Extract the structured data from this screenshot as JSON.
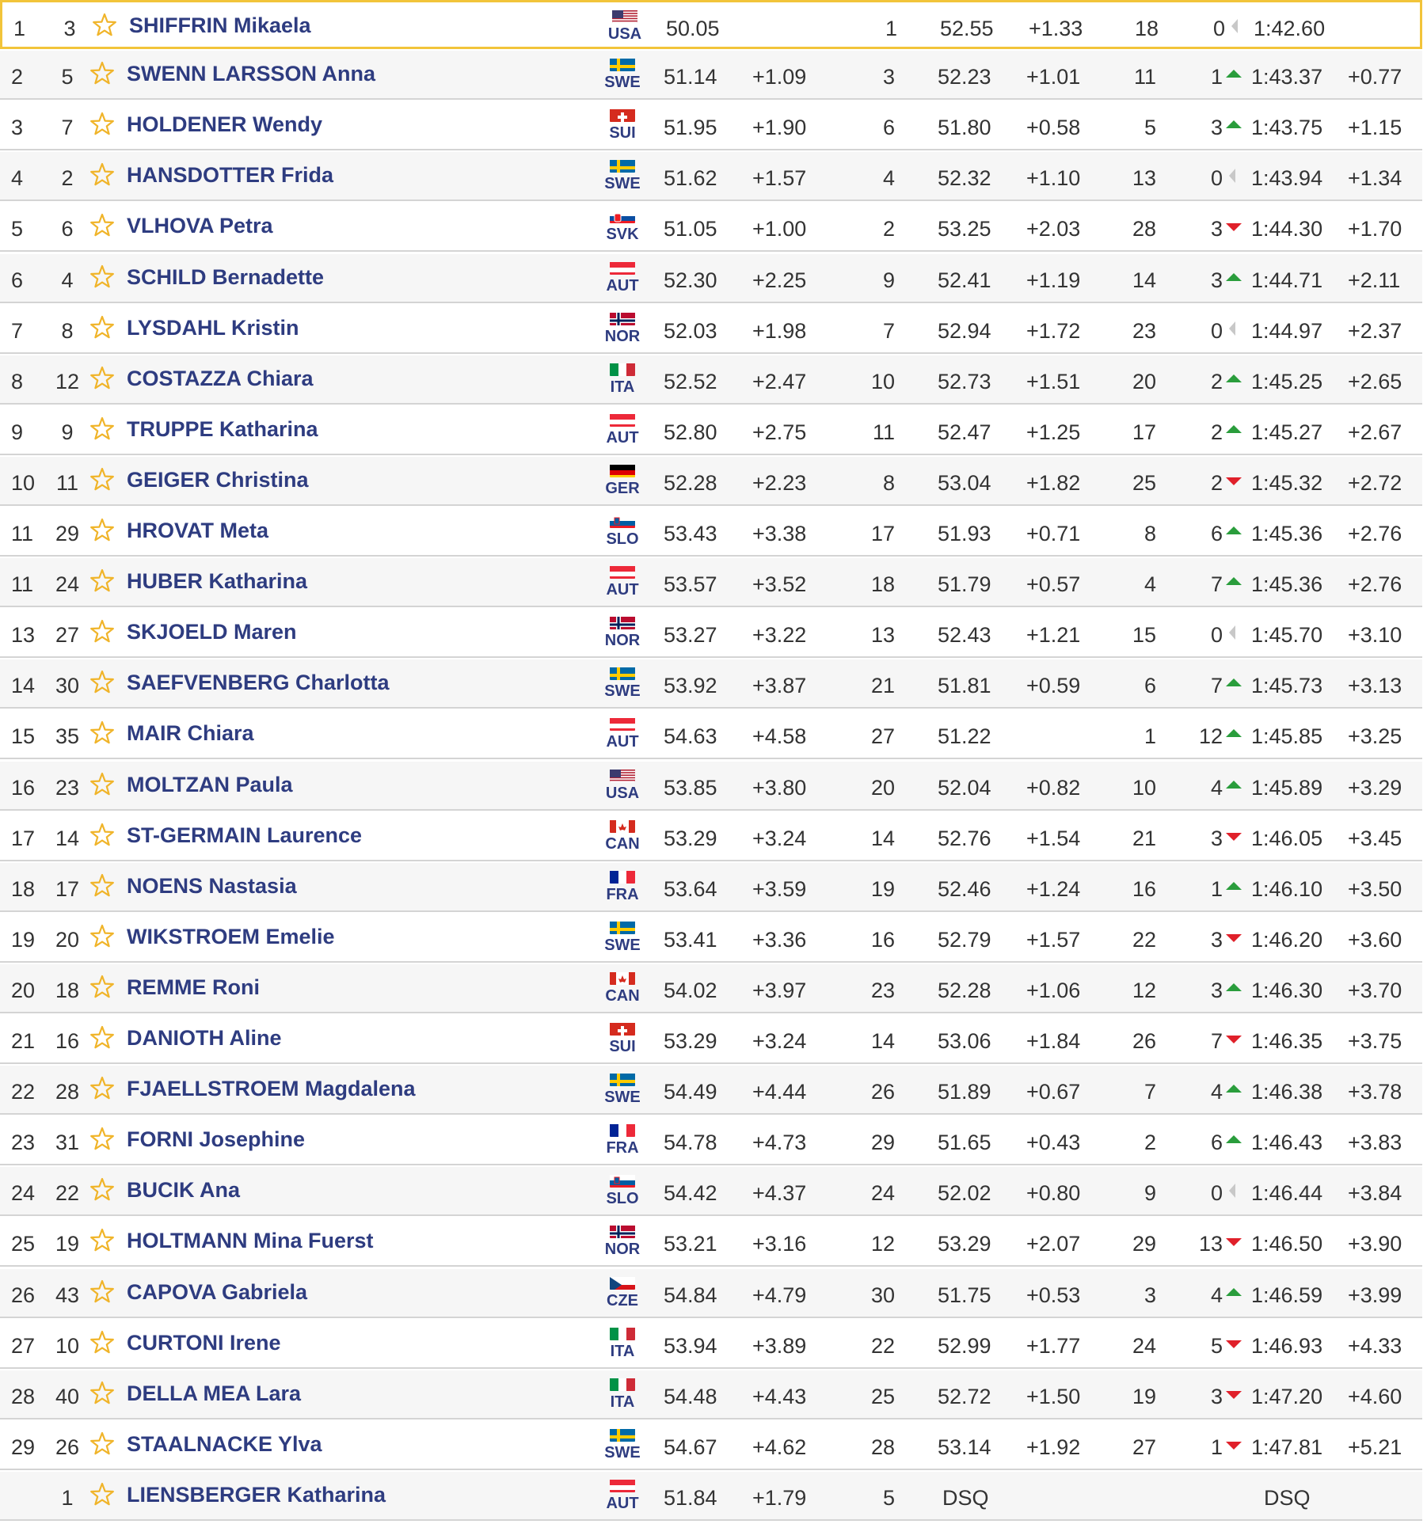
{
  "colors": {
    "name_text": "#2e3c80",
    "star": "#f0b429",
    "highlight_border": "#f2c43a",
    "arrow_up": "#2a9d3c",
    "arrow_down": "#e0202a",
    "arrow_same": "#c8c8c8"
  },
  "icons": {
    "favorite": "star-outline-icon",
    "up": "triangle-up-icon",
    "down": "triangle-down-icon",
    "same": "triangle-left-icon"
  },
  "rows": [
    {
      "rank": "1",
      "bib": "3",
      "name": "SHIFFRIN Mikaela",
      "nat": "USA",
      "r1_time": "50.05",
      "r1_diff": "",
      "r2_rank": "1",
      "r2_time": "52.55",
      "r2_diff": "+1.33",
      "run2_rank": "18",
      "move": "0",
      "dir": "same",
      "total": "1:42.60",
      "total_diff": "",
      "highlight": true
    },
    {
      "rank": "2",
      "bib": "5",
      "name": "SWENN LARSSON Anna",
      "nat": "SWE",
      "r1_time": "51.14",
      "r1_diff": "+1.09",
      "r2_rank": "3",
      "r2_time": "52.23",
      "r2_diff": "+1.01",
      "run2_rank": "11",
      "move": "1",
      "dir": "up",
      "total": "1:43.37",
      "total_diff": "+0.77"
    },
    {
      "rank": "3",
      "bib": "7",
      "name": "HOLDENER Wendy",
      "nat": "SUI",
      "r1_time": "51.95",
      "r1_diff": "+1.90",
      "r2_rank": "6",
      "r2_time": "51.80",
      "r2_diff": "+0.58",
      "run2_rank": "5",
      "move": "3",
      "dir": "up",
      "total": "1:43.75",
      "total_diff": "+1.15"
    },
    {
      "rank": "4",
      "bib": "2",
      "name": "HANSDOTTER Frida",
      "nat": "SWE",
      "r1_time": "51.62",
      "r1_diff": "+1.57",
      "r2_rank": "4",
      "r2_time": "52.32",
      "r2_diff": "+1.10",
      "run2_rank": "13",
      "move": "0",
      "dir": "same",
      "total": "1:43.94",
      "total_diff": "+1.34"
    },
    {
      "rank": "5",
      "bib": "6",
      "name": "VLHOVA Petra",
      "nat": "SVK",
      "r1_time": "51.05",
      "r1_diff": "+1.00",
      "r2_rank": "2",
      "r2_time": "53.25",
      "r2_diff": "+2.03",
      "run2_rank": "28",
      "move": "3",
      "dir": "down",
      "total": "1:44.30",
      "total_diff": "+1.70"
    },
    {
      "rank": "6",
      "bib": "4",
      "name": "SCHILD Bernadette",
      "nat": "AUT",
      "r1_time": "52.30",
      "r1_diff": "+2.25",
      "r2_rank": "9",
      "r2_time": "52.41",
      "r2_diff": "+1.19",
      "run2_rank": "14",
      "move": "3",
      "dir": "up",
      "total": "1:44.71",
      "total_diff": "+2.11"
    },
    {
      "rank": "7",
      "bib": "8",
      "name": "LYSDAHL Kristin",
      "nat": "NOR",
      "r1_time": "52.03",
      "r1_diff": "+1.98",
      "r2_rank": "7",
      "r2_time": "52.94",
      "r2_diff": "+1.72",
      "run2_rank": "23",
      "move": "0",
      "dir": "same",
      "total": "1:44.97",
      "total_diff": "+2.37"
    },
    {
      "rank": "8",
      "bib": "12",
      "name": "COSTAZZA Chiara",
      "nat": "ITA",
      "r1_time": "52.52",
      "r1_diff": "+2.47",
      "r2_rank": "10",
      "r2_time": "52.73",
      "r2_diff": "+1.51",
      "run2_rank": "20",
      "move": "2",
      "dir": "up",
      "total": "1:45.25",
      "total_diff": "+2.65"
    },
    {
      "rank": "9",
      "bib": "9",
      "name": "TRUPPE Katharina",
      "nat": "AUT",
      "r1_time": "52.80",
      "r1_diff": "+2.75",
      "r2_rank": "11",
      "r2_time": "52.47",
      "r2_diff": "+1.25",
      "run2_rank": "17",
      "move": "2",
      "dir": "up",
      "total": "1:45.27",
      "total_diff": "+2.67"
    },
    {
      "rank": "10",
      "bib": "11",
      "name": "GEIGER Christina",
      "nat": "GER",
      "r1_time": "52.28",
      "r1_diff": "+2.23",
      "r2_rank": "8",
      "r2_time": "53.04",
      "r2_diff": "+1.82",
      "run2_rank": "25",
      "move": "2",
      "dir": "down",
      "total": "1:45.32",
      "total_diff": "+2.72"
    },
    {
      "rank": "11",
      "bib": "29",
      "name": "HROVAT Meta",
      "nat": "SLO",
      "r1_time": "53.43",
      "r1_diff": "+3.38",
      "r2_rank": "17",
      "r2_time": "51.93",
      "r2_diff": "+0.71",
      "run2_rank": "8",
      "move": "6",
      "dir": "up",
      "total": "1:45.36",
      "total_diff": "+2.76"
    },
    {
      "rank": "11",
      "bib": "24",
      "name": "HUBER Katharina",
      "nat": "AUT",
      "r1_time": "53.57",
      "r1_diff": "+3.52",
      "r2_rank": "18",
      "r2_time": "51.79",
      "r2_diff": "+0.57",
      "run2_rank": "4",
      "move": "7",
      "dir": "up",
      "total": "1:45.36",
      "total_diff": "+2.76"
    },
    {
      "rank": "13",
      "bib": "27",
      "name": "SKJOELD Maren",
      "nat": "NOR",
      "r1_time": "53.27",
      "r1_diff": "+3.22",
      "r2_rank": "13",
      "r2_time": "52.43",
      "r2_diff": "+1.21",
      "run2_rank": "15",
      "move": "0",
      "dir": "same",
      "total": "1:45.70",
      "total_diff": "+3.10"
    },
    {
      "rank": "14",
      "bib": "30",
      "name": "SAEFVENBERG Charlotta",
      "nat": "SWE",
      "r1_time": "53.92",
      "r1_diff": "+3.87",
      "r2_rank": "21",
      "r2_time": "51.81",
      "r2_diff": "+0.59",
      "run2_rank": "6",
      "move": "7",
      "dir": "up",
      "total": "1:45.73",
      "total_diff": "+3.13"
    },
    {
      "rank": "15",
      "bib": "35",
      "name": "MAIR Chiara",
      "nat": "AUT",
      "r1_time": "54.63",
      "r1_diff": "+4.58",
      "r2_rank": "27",
      "r2_time": "51.22",
      "r2_diff": "",
      "run2_rank": "1",
      "move": "12",
      "dir": "up",
      "total": "1:45.85",
      "total_diff": "+3.25"
    },
    {
      "rank": "16",
      "bib": "23",
      "name": "MOLTZAN Paula",
      "nat": "USA",
      "r1_time": "53.85",
      "r1_diff": "+3.80",
      "r2_rank": "20",
      "r2_time": "52.04",
      "r2_diff": "+0.82",
      "run2_rank": "10",
      "move": "4",
      "dir": "up",
      "total": "1:45.89",
      "total_diff": "+3.29"
    },
    {
      "rank": "17",
      "bib": "14",
      "name": "ST-GERMAIN Laurence",
      "nat": "CAN",
      "r1_time": "53.29",
      "r1_diff": "+3.24",
      "r2_rank": "14",
      "r2_time": "52.76",
      "r2_diff": "+1.54",
      "run2_rank": "21",
      "move": "3",
      "dir": "down",
      "total": "1:46.05",
      "total_diff": "+3.45"
    },
    {
      "rank": "18",
      "bib": "17",
      "name": "NOENS Nastasia",
      "nat": "FRA",
      "r1_time": "53.64",
      "r1_diff": "+3.59",
      "r2_rank": "19",
      "r2_time": "52.46",
      "r2_diff": "+1.24",
      "run2_rank": "16",
      "move": "1",
      "dir": "up",
      "total": "1:46.10",
      "total_diff": "+3.50"
    },
    {
      "rank": "19",
      "bib": "20",
      "name": "WIKSTROEM Emelie",
      "nat": "SWE",
      "r1_time": "53.41",
      "r1_diff": "+3.36",
      "r2_rank": "16",
      "r2_time": "52.79",
      "r2_diff": "+1.57",
      "run2_rank": "22",
      "move": "3",
      "dir": "down",
      "total": "1:46.20",
      "total_diff": "+3.60"
    },
    {
      "rank": "20",
      "bib": "18",
      "name": "REMME Roni",
      "nat": "CAN",
      "r1_time": "54.02",
      "r1_diff": "+3.97",
      "r2_rank": "23",
      "r2_time": "52.28",
      "r2_diff": "+1.06",
      "run2_rank": "12",
      "move": "3",
      "dir": "up",
      "total": "1:46.30",
      "total_diff": "+3.70"
    },
    {
      "rank": "21",
      "bib": "16",
      "name": "DANIOTH Aline",
      "nat": "SUI",
      "r1_time": "53.29",
      "r1_diff": "+3.24",
      "r2_rank": "14",
      "r2_time": "53.06",
      "r2_diff": "+1.84",
      "run2_rank": "26",
      "move": "7",
      "dir": "down",
      "total": "1:46.35",
      "total_diff": "+3.75"
    },
    {
      "rank": "22",
      "bib": "28",
      "name": "FJAELLSTROEM Magdalena",
      "nat": "SWE",
      "r1_time": "54.49",
      "r1_diff": "+4.44",
      "r2_rank": "26",
      "r2_time": "51.89",
      "r2_diff": "+0.67",
      "run2_rank": "7",
      "move": "4",
      "dir": "up",
      "total": "1:46.38",
      "total_diff": "+3.78"
    },
    {
      "rank": "23",
      "bib": "31",
      "name": "FORNI Josephine",
      "nat": "FRA",
      "r1_time": "54.78",
      "r1_diff": "+4.73",
      "r2_rank": "29",
      "r2_time": "51.65",
      "r2_diff": "+0.43",
      "run2_rank": "2",
      "move": "6",
      "dir": "up",
      "total": "1:46.43",
      "total_diff": "+3.83"
    },
    {
      "rank": "24",
      "bib": "22",
      "name": "BUCIK Ana",
      "nat": "SLO",
      "r1_time": "54.42",
      "r1_diff": "+4.37",
      "r2_rank": "24",
      "r2_time": "52.02",
      "r2_diff": "+0.80",
      "run2_rank": "9",
      "move": "0",
      "dir": "same",
      "total": "1:46.44",
      "total_diff": "+3.84"
    },
    {
      "rank": "25",
      "bib": "19",
      "name": "HOLTMANN Mina Fuerst",
      "nat": "NOR",
      "r1_time": "53.21",
      "r1_diff": "+3.16",
      "r2_rank": "12",
      "r2_time": "53.29",
      "r2_diff": "+2.07",
      "run2_rank": "29",
      "move": "13",
      "dir": "down",
      "total": "1:46.50",
      "total_diff": "+3.90"
    },
    {
      "rank": "26",
      "bib": "43",
      "name": "CAPOVA Gabriela",
      "nat": "CZE",
      "r1_time": "54.84",
      "r1_diff": "+4.79",
      "r2_rank": "30",
      "r2_time": "51.75",
      "r2_diff": "+0.53",
      "run2_rank": "3",
      "move": "4",
      "dir": "up",
      "total": "1:46.59",
      "total_diff": "+3.99"
    },
    {
      "rank": "27",
      "bib": "10",
      "name": "CURTONI Irene",
      "nat": "ITA",
      "r1_time": "53.94",
      "r1_diff": "+3.89",
      "r2_rank": "22",
      "r2_time": "52.99",
      "r2_diff": "+1.77",
      "run2_rank": "24",
      "move": "5",
      "dir": "down",
      "total": "1:46.93",
      "total_diff": "+4.33"
    },
    {
      "rank": "28",
      "bib": "40",
      "name": "DELLA MEA Lara",
      "nat": "ITA",
      "r1_time": "54.48",
      "r1_diff": "+4.43",
      "r2_rank": "25",
      "r2_time": "52.72",
      "r2_diff": "+1.50",
      "run2_rank": "19",
      "move": "3",
      "dir": "down",
      "total": "1:47.20",
      "total_diff": "+4.60"
    },
    {
      "rank": "29",
      "bib": "26",
      "name": "STAALNACKE Ylva",
      "nat": "SWE",
      "r1_time": "54.67",
      "r1_diff": "+4.62",
      "r2_rank": "28",
      "r2_time": "53.14",
      "r2_diff": "+1.92",
      "run2_rank": "27",
      "move": "1",
      "dir": "down",
      "total": "1:47.81",
      "total_diff": "+5.21"
    },
    {
      "rank": "",
      "bib": "1",
      "name": "LIENSBERGER Katharina",
      "nat": "AUT",
      "r1_time": "51.84",
      "r1_diff": "+1.79",
      "r2_rank": "5",
      "r2_time": "",
      "r2_diff": "",
      "run2_rank": "",
      "move": "",
      "dir": "",
      "total": "",
      "total_diff": "",
      "dsq_run2": "DSQ",
      "dsq_total": "DSQ"
    }
  ]
}
